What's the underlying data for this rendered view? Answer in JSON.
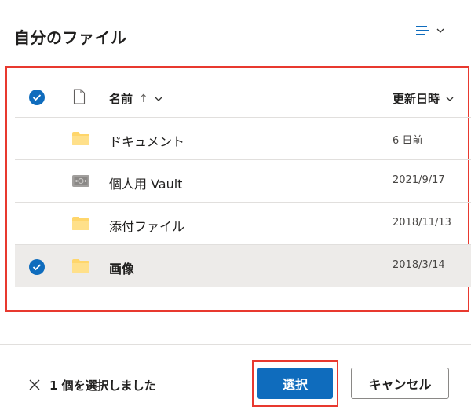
{
  "header": {
    "title": "自分のファイル",
    "view_icon": "list-view-icon"
  },
  "columns": {
    "name": "名前",
    "sort_arrow": "↑",
    "modified": "更新日時"
  },
  "files": [
    {
      "name": "ドキュメント",
      "modified": "6 日前",
      "icon": "folder-icon",
      "selected": false
    },
    {
      "name": "個人用 Vault",
      "modified": "2021/9/17",
      "icon": "vault-icon",
      "selected": false
    },
    {
      "name": "添付ファイル",
      "modified": "2018/11/13",
      "icon": "folder-icon",
      "selected": false
    },
    {
      "name": "画像",
      "modified": "2018/3/14",
      "icon": "folder-icon",
      "selected": true
    }
  ],
  "footer": {
    "selection_text": "1 個を選択しました",
    "select_label": "選択",
    "cancel_label": "キャンセル"
  },
  "colors": {
    "accent": "#0f6cbd",
    "folder": "#ffd66b",
    "highlight": "#e8392f",
    "selected_row": "#edebe9"
  }
}
